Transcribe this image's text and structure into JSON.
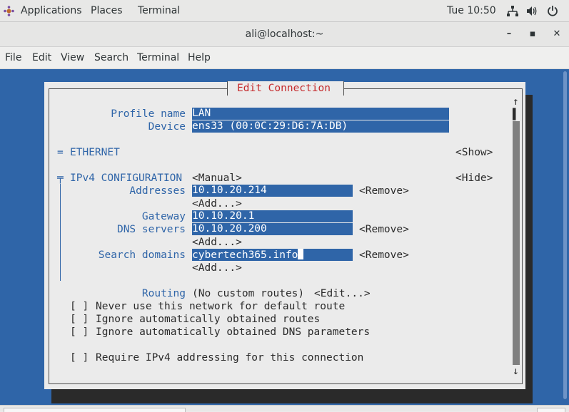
{
  "topbar": {
    "applications": "Applications",
    "places": "Places",
    "terminal": "Terminal",
    "clock": "Tue 10:50",
    "icons": [
      "network-icon",
      "volume-icon",
      "power-icon"
    ]
  },
  "window": {
    "title": "ali@localhost:~",
    "minimize": "–",
    "maximize": "▪",
    "close": "✕"
  },
  "menu": [
    "File",
    "Edit",
    "View",
    "Search",
    "Terminal",
    "Help"
  ],
  "dialog": {
    "title": "Edit Connection",
    "profile_name_label": "Profile name",
    "profile_name": "LAN",
    "device_label": "Device",
    "device": "ens33 (00:0C:29:D6:7A:DB)",
    "ethernet_marker": "=",
    "ethernet_label": "ETHERNET",
    "ethernet_toggle": "<Show>",
    "ipv4_marker": "╤",
    "ipv4_label": "IPv4 CONFIGURATION",
    "ipv4_method": "<Manual>",
    "ipv4_toggle": "<Hide>",
    "addresses_label": "Addresses",
    "address": "10.10.20.214",
    "gateway_label": "Gateway",
    "gateway": "10.10.20.1",
    "dns_label": "DNS servers",
    "dns": "10.10.20.200",
    "search_label": "Search domains",
    "search_domain": "cybertech365.info",
    "remove": "<Remove>",
    "add": "<Add...>",
    "routing_label": "Routing",
    "routing_value": "(No custom routes)",
    "routing_edit": "<Edit...>",
    "checkbox": "[ ]",
    "never_default": "Never use this network for default route",
    "ignore_routes": "Ignore automatically obtained routes",
    "ignore_dns": "Ignore automatically obtained DNS parameters",
    "require_ipv4": "Require IPv4 addressing for this connection",
    "scroll_up": "↑",
    "scroll_down": "↓",
    "scroll_thumb": "▌"
  },
  "colors": {
    "terminal_bg": "#2f65a8",
    "dialog_bg": "#ebebeb",
    "label_blue": "#2f65a8",
    "title_red": "#c4292b"
  }
}
